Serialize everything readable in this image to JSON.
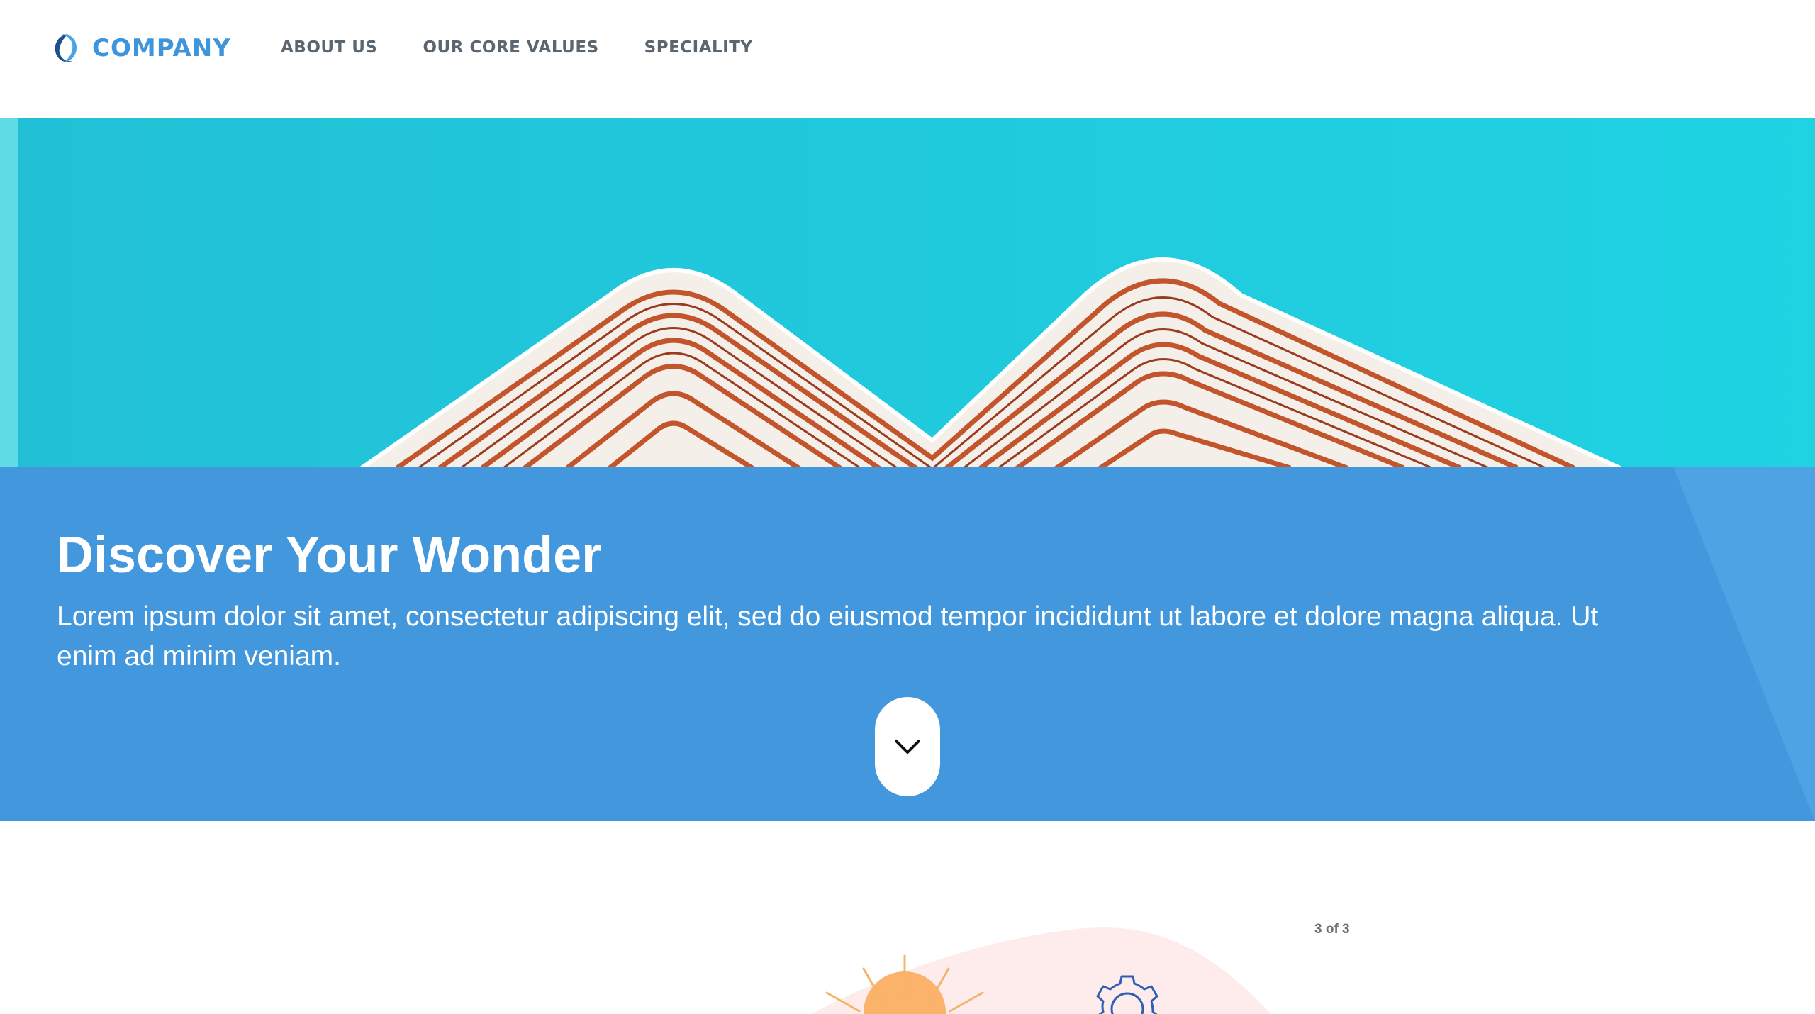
{
  "brand": {
    "name": "COMPANY",
    "color": "#3f95db"
  },
  "nav": {
    "items": [
      {
        "label": "ABOUT US"
      },
      {
        "label": "OUR CORE VALUES"
      },
      {
        "label": "SPECIALITY"
      }
    ]
  },
  "hero": {
    "title": "Discover Your Wonder",
    "text": "Lorem ipsum dolor sit amet, consectetur adipiscing elit, sed do eiusmod tempor incididunt ut labore et dolore magna aliqua. Ut enim ad minim veniam.",
    "panel_color": "#4297dd",
    "sky_color": "#1ccfe0",
    "scroll_icon": "chevron-down-icon"
  },
  "carousel": {
    "counter": "3 of 3"
  },
  "icons": [
    "company-logo-icon",
    "chevron-down-icon",
    "sun-icon",
    "gear-icon"
  ]
}
